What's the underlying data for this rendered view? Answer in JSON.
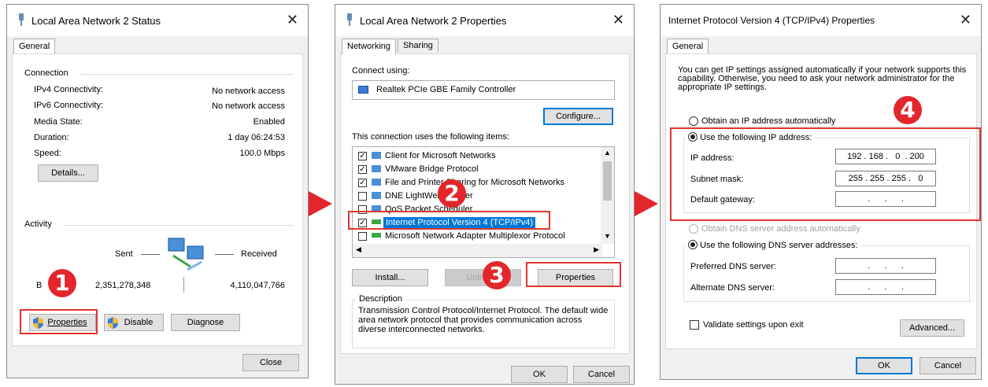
{
  "colors": {
    "accent": "#e3262c",
    "selection": "#0078d7",
    "dialog_bg": "#f0f0f0"
  },
  "win1": {
    "title": "Local Area Network 2 Status",
    "tab": "General",
    "connection_label": "Connection",
    "rows": [
      {
        "label": "IPv4 Connectivity:",
        "value": "No network access"
      },
      {
        "label": "IPv6 Connectivity:",
        "value": "No network access"
      },
      {
        "label": "Media State:",
        "value": "Enabled"
      },
      {
        "label": "Duration:",
        "value": "1 day 06:24:53"
      },
      {
        "label": "Speed:",
        "value": "100.0 Mbps"
      }
    ],
    "details_button": "Details...",
    "activity_label": "Activity",
    "sent_label": "Sent",
    "received_label": "Received",
    "bytes_label": "B",
    "bytes_sent": "2,351,278,348",
    "bytes_received": "4,110,047,766",
    "properties_button": "Properties",
    "disable_button": "Disable",
    "diagnose_button": "Diagnose",
    "close_button": "Close",
    "badge": "1"
  },
  "win2": {
    "title": "Local Area Network 2 Properties",
    "tabs": [
      "Networking",
      "Sharing"
    ],
    "connect_using_label": "Connect using:",
    "adapter_name": "Realtek PCIe GBE Family Controller",
    "configure_button": "Configure...",
    "items_label": "This connection uses the following items:",
    "items": [
      {
        "label": "Client for Microsoft Networks",
        "checked": true
      },
      {
        "label": "VMware Bridge Protocol",
        "checked": true
      },
      {
        "label": "File and Printer Sharing for Microsoft Networks",
        "checked": true
      },
      {
        "label": "DNE LightWeight Filter",
        "checked": false
      },
      {
        "label": "QoS Packet Scheduler",
        "checked": false
      },
      {
        "label": "Internet Protocol Version 4 (TCP/IPv4)",
        "checked": true
      },
      {
        "label": "Microsoft Network Adapter Multiplexor Protocol",
        "checked": false
      }
    ],
    "install_button": "Install...",
    "uninstall_button": "Uninstall",
    "properties_button": "Properties",
    "description_label": "Description",
    "description_text": "Transmission Control Protocol/Internet Protocol. The default wide area network protocol that provides communication across diverse interconnected networks.",
    "ok_button": "OK",
    "cancel_button": "Cancel",
    "badge2": "2",
    "badge3": "3"
  },
  "win3": {
    "title": "Internet Protocol Version 4 (TCP/IPv4) Properties",
    "tab": "General",
    "intro": "You can get IP settings assigned automatically if your network supports this capability. Otherwise, you need to ask your network administrator for the appropriate IP settings.",
    "obtain_ip_auto": "Obtain an IP address automatically",
    "use_following_ip": "Use the following IP address:",
    "ip_address_label": "IP address:",
    "ip_address": "192 . 168 .   0  . 200",
    "subnet_label": "Subnet mask:",
    "subnet": "255 . 255 . 255 .   0",
    "gateway_label": "Default gateway:",
    "gateway": "   .      .      .   ",
    "obtain_dns_auto": "Obtain DNS server address automatically",
    "use_following_dns": "Use the following DNS server addresses:",
    "preferred_dns_label": "Preferred DNS server:",
    "preferred_dns": "   .      .      .   ",
    "alternate_dns_label": "Alternate DNS server:",
    "alternate_dns": "   .      .      .   ",
    "validate_label": "Validate settings upon exit",
    "advanced_button": "Advanced...",
    "ok_button": "OK",
    "cancel_button": "Cancel",
    "badge": "4"
  }
}
